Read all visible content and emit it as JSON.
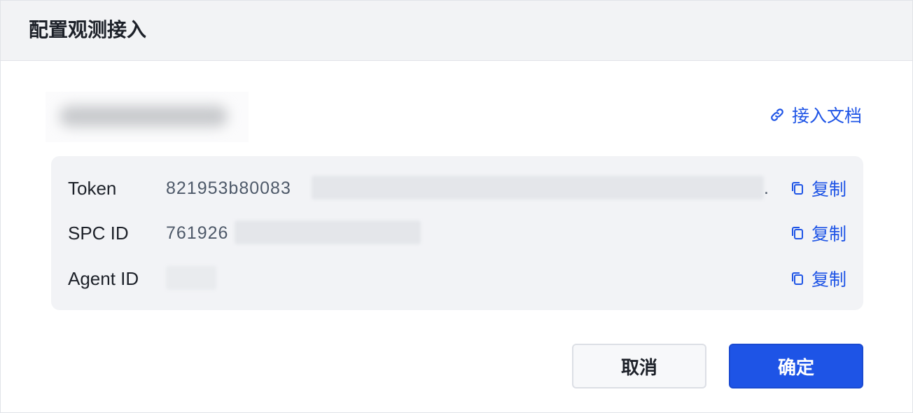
{
  "dialog": {
    "title": "配置观测接入",
    "doc_link": {
      "label": "接入文档",
      "icon": "link-icon"
    },
    "rows": [
      {
        "label": "Token",
        "value": "821953b80083",
        "trailing": ".",
        "copy_label": "复制"
      },
      {
        "label": "SPC ID",
        "value": "761926",
        "copy_label": "复制"
      },
      {
        "label": "Agent ID",
        "value": "",
        "copy_label": "复制"
      }
    ],
    "buttons": {
      "cancel": "取消",
      "confirm": "确定"
    }
  },
  "colors": {
    "accent": "#1e54e6",
    "header_bg": "#f2f3f5",
    "panel_bg": "#f2f3f6",
    "text_primary": "#1d2129",
    "text_secondary": "#4e5969"
  }
}
